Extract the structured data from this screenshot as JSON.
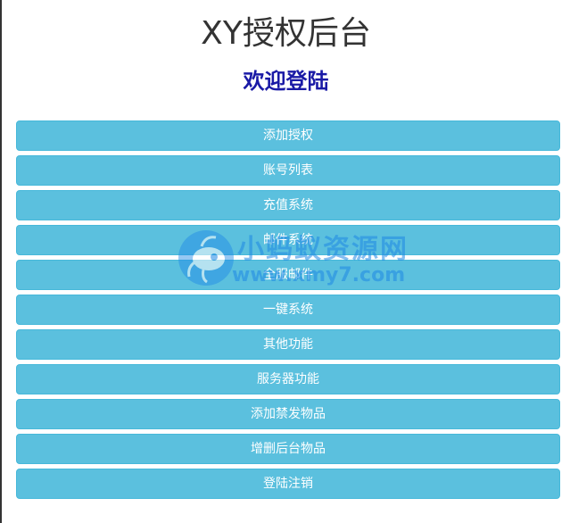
{
  "header": {
    "title": "XY授权后台",
    "subtitle": "欢迎登陆"
  },
  "menu": {
    "items": [
      {
        "label": "添加授权"
      },
      {
        "label": "账号列表"
      },
      {
        "label": "充值系统"
      },
      {
        "label": "邮件系统"
      },
      {
        "label": "全服邮件"
      },
      {
        "label": "一键系统"
      },
      {
        "label": "其他功能"
      },
      {
        "label": "服务器功能"
      },
      {
        "label": "添加禁发物品"
      },
      {
        "label": "增删后台物品"
      },
      {
        "label": "登陆注销"
      }
    ]
  },
  "watermark": {
    "text": "小蚂蚁资源网",
    "url": "www.xmy7.com",
    "icon": "ant-logo-icon"
  },
  "colors": {
    "button_bg": "#5bc0de",
    "button_border": "#46b8da",
    "subtitle": "#1a1aa6",
    "watermark": "#1e88e5"
  }
}
